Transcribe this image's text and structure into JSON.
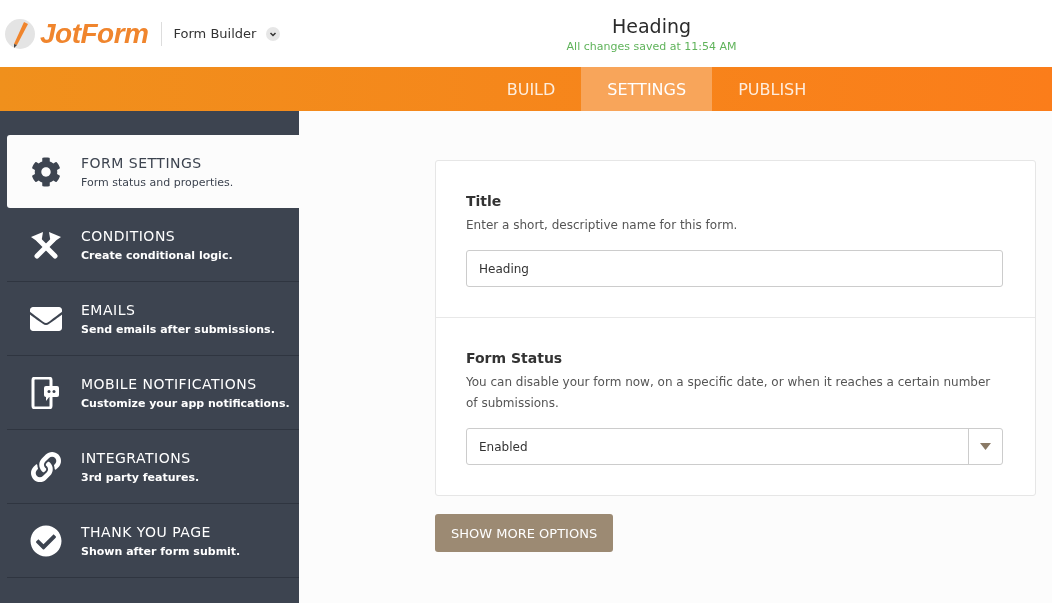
{
  "header": {
    "logo": "JotForm",
    "app_menu": "Form Builder",
    "title": "Heading",
    "save_status": "All changes saved at 11:54 AM"
  },
  "tabs": [
    {
      "label": "BUILD",
      "selected": false
    },
    {
      "label": "SETTINGS",
      "selected": true
    },
    {
      "label": "PUBLISH",
      "selected": false
    }
  ],
  "sidebar": {
    "items": [
      {
        "kind": "gear",
        "title": "FORM SETTINGS",
        "subtitle": "Form status and properties.",
        "selected": true
      },
      {
        "kind": "conditions",
        "title": "CONDITIONS",
        "subtitle": "Create conditional logic.",
        "selected": false
      },
      {
        "kind": "email",
        "title": "EMAILS",
        "subtitle": "Send emails after submissions.",
        "selected": false
      },
      {
        "kind": "mobile",
        "title": "MOBILE NOTIFICATIONS",
        "subtitle": "Customize your app notifications.",
        "selected": false
      },
      {
        "kind": "link",
        "title": "INTEGRATIONS",
        "subtitle": "3rd party features.",
        "selected": false
      },
      {
        "kind": "check",
        "title": "THANK YOU PAGE",
        "subtitle": "Shown after form submit.",
        "selected": false
      }
    ]
  },
  "settings": [
    {
      "kind": "text",
      "label": "Title",
      "description": "Enter a short, descriptive name for this form.",
      "value": "Heading"
    },
    {
      "kind": "select",
      "label": "Form Status",
      "description": "You can disable your form now, on a specific date, or when it reaches a certain number of submissions.",
      "value": "Enabled"
    }
  ],
  "more_button": "SHOW MORE OPTIONS"
}
